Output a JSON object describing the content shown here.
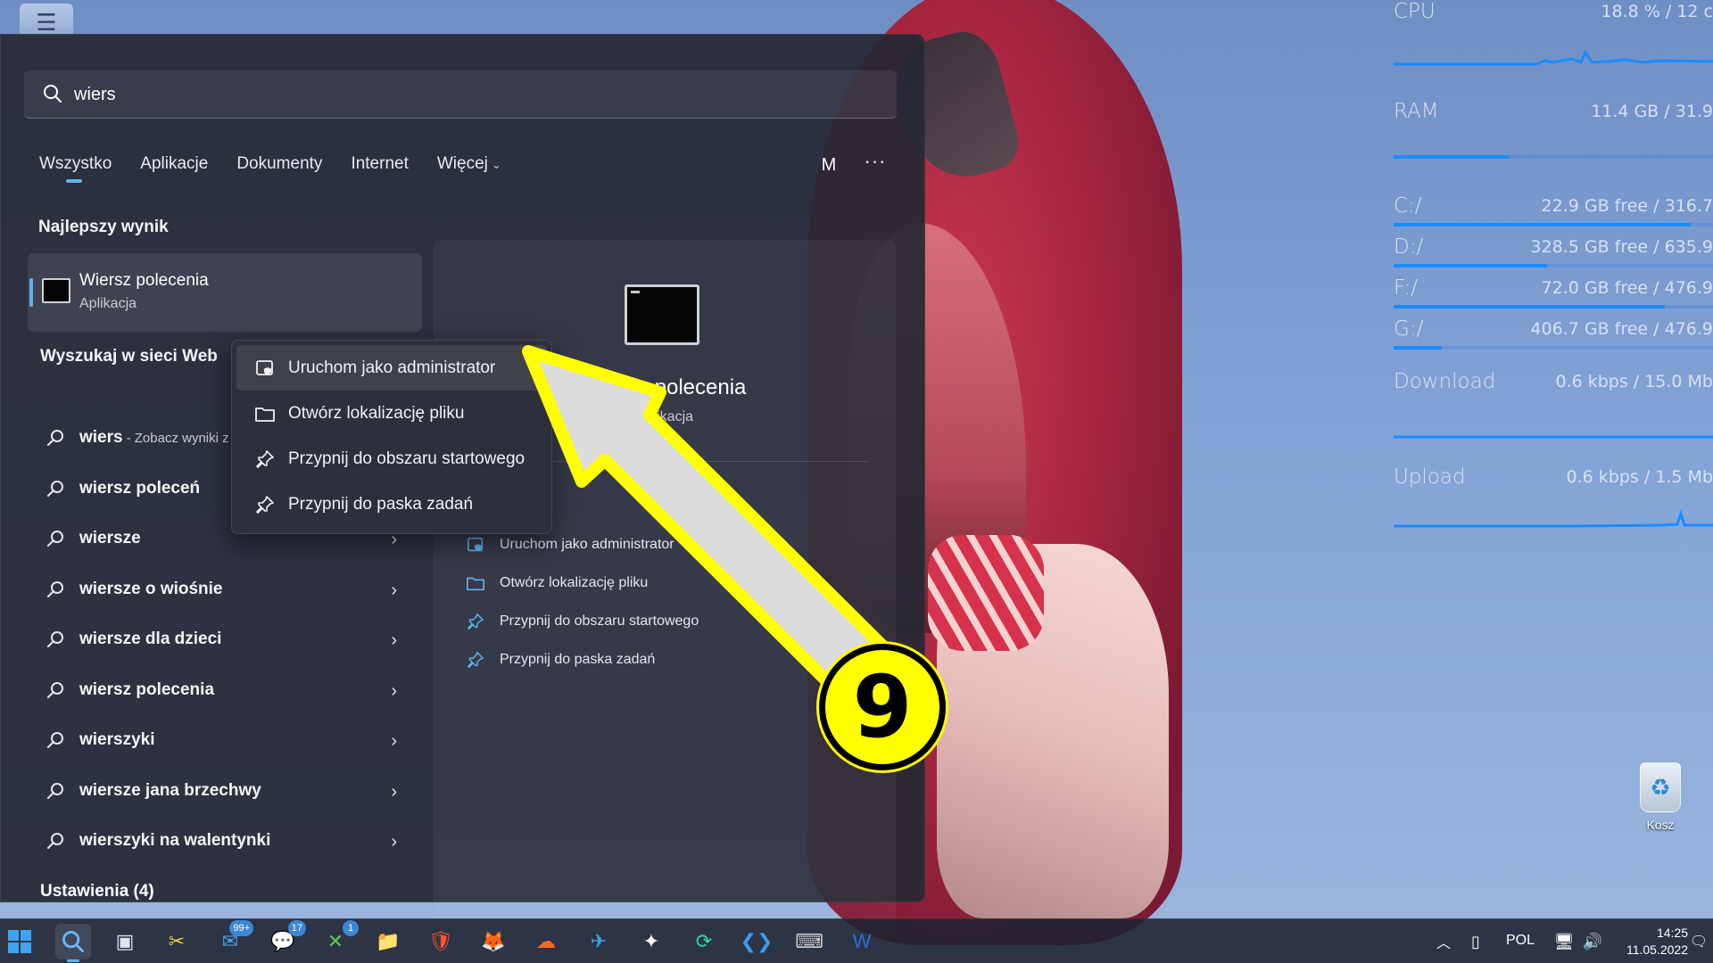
{
  "search": {
    "query": "wiers"
  },
  "tabs": [
    {
      "label": "Wszystko"
    },
    {
      "label": "Aplikacje"
    },
    {
      "label": "Dokumenty"
    },
    {
      "label": "Internet"
    },
    {
      "label": "Więcej"
    }
  ],
  "account": {
    "initial": "M",
    "more_label": "···"
  },
  "best_match": {
    "section_title": "Najlepszy wynik",
    "title": "Wiersz polecenia",
    "subtitle": "Aplikacja"
  },
  "web": {
    "section_title": "Wyszukaj w sieci Web",
    "items": [
      {
        "text": "wiers",
        "hint": "- Zobacz wyniki z"
      },
      {
        "text": "wiersz poleceń"
      },
      {
        "text": "wiersze"
      },
      {
        "text": "wiersze o wiośnie"
      },
      {
        "text": "wiersze dla dzieci"
      },
      {
        "text": "wiersz polecenia"
      },
      {
        "text": "wierszyki"
      },
      {
        "text": "wiersze jana brzechwy"
      },
      {
        "text": "wierszyki na walentynki"
      }
    ]
  },
  "settings": {
    "section_title": "Ustawienia (4)"
  },
  "context_menu": {
    "items": [
      {
        "label": "Uruchom jako administrator",
        "icon": "shield-icon"
      },
      {
        "label": "Otwórz lokalizację pliku",
        "icon": "folder-icon"
      },
      {
        "label": "Przypnij do obszaru startowego",
        "icon": "pin-icon"
      },
      {
        "label": "Przypnij do paska zadań",
        "icon": "pin-icon"
      }
    ]
  },
  "preview": {
    "title": "Wiersz polecenia",
    "subtitle": "Aplikacja",
    "actions": [
      {
        "label": "Uruchom jako administrator",
        "icon": "shield-icon"
      },
      {
        "label": "Otwórz lokalizację pliku",
        "icon": "folder-icon"
      },
      {
        "label": "Przypnij do obszaru startowego",
        "icon": "pin-icon"
      },
      {
        "label": "Przypnij do paska zadań",
        "icon": "pin-icon"
      }
    ]
  },
  "annotation": {
    "step_number": "9",
    "color": "#ffff00"
  },
  "monitor": {
    "cpu": {
      "label": "CPU",
      "value": "18.8 % / 12 c"
    },
    "ram": {
      "label": "RAM",
      "value": "11.4 GB / 31.9",
      "fill": 0.36
    },
    "drives": [
      {
        "label": "C:/",
        "value": "22.9 GB free / 316.7",
        "fill": 0.93
      },
      {
        "label": "D:/",
        "value": "328.5 GB free / 635.9",
        "fill": 0.48
      },
      {
        "label": "F:/",
        "value": "72.0 GB free / 476.9",
        "fill": 0.85
      },
      {
        "label": "G:/",
        "value": "406.7 GB free / 476.9",
        "fill": 0.15
      }
    ],
    "download": {
      "label": "Download",
      "value": "0.6 kbps / 15.0 Mb"
    },
    "upload": {
      "label": "Upload",
      "value": "0.6 kbps / 1.5 Mb"
    }
  },
  "desktop": {
    "recycle_label": "Kosz"
  },
  "taskbar": {
    "badges": {
      "mail": "99+",
      "messages": "17",
      "xbox": "1"
    },
    "language": "POL",
    "time": "14:25",
    "date": "11.05.2022"
  },
  "colors": {
    "accent": "#5fb2f2",
    "panel": "#26283a",
    "monitor_bar": "#1a8cff"
  }
}
